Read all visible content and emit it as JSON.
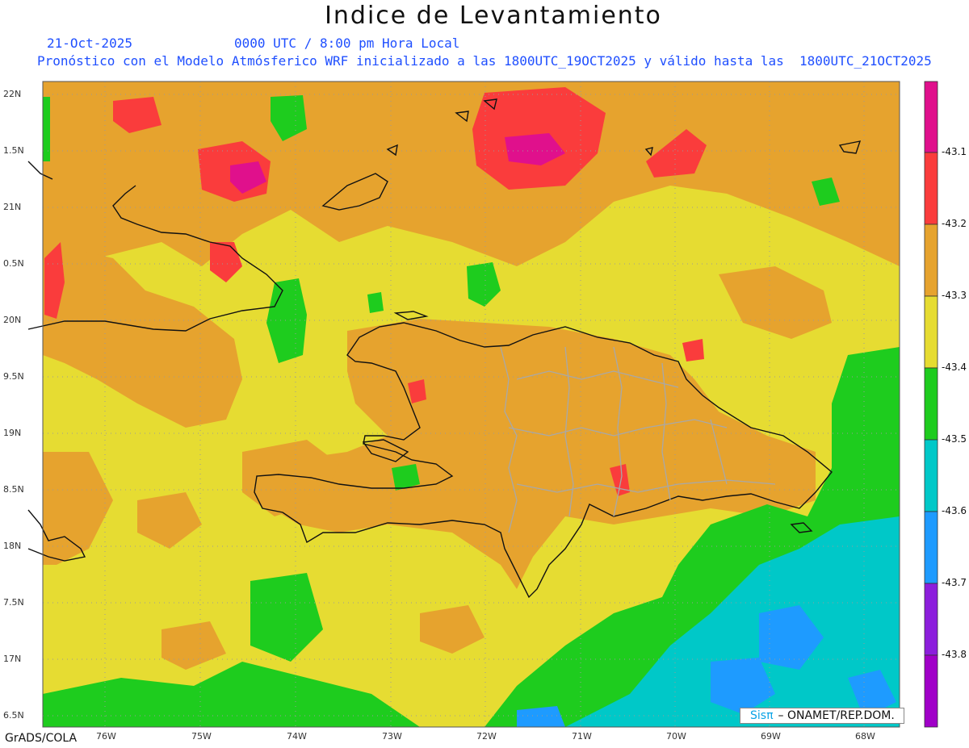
{
  "title": "Indice de Levantamiento",
  "subtitle": {
    "date": "21-Oct-2025",
    "time": "0000 UTC / 8:00 pm Hora Local",
    "forecast": "Pronóstico con el Modelo Atmósferico WRF inicializado a las 1800UTC_19OCT2025 y válido hasta las  1800UTC_21OCT2025"
  },
  "credit": "GrADS/COLA",
  "badge": {
    "logo": "Sisπ",
    "org": "– ONAMET/REP.DOM."
  },
  "latitude_labels": [
    "22N",
    "1.5N",
    "21N",
    "0.5N",
    "20N",
    "9.5N",
    "19N",
    "8.5N",
    "18N",
    "7.5N",
    "17N",
    "6.5N"
  ],
  "longitude_labels": [
    "76W",
    "75W",
    "74W",
    "73W",
    "72W",
    "71W",
    "70W",
    "69W",
    "68W"
  ],
  "colorbar": {
    "labels": [
      "-43.1",
      "-43.2",
      "-43.3",
      "-43.4",
      "-43.5",
      "-43.6",
      "-43.7",
      "-43.8"
    ],
    "colors": [
      "#e0108c",
      "#fa3c3c",
      "#e6a32e",
      "#e6dc32",
      "#1ecc1e",
      "#00c8c8",
      "#1e9bff",
      "#8c1edc",
      "#a000c8"
    ]
  },
  "field_colors": {
    "yellow": "#e6dc32",
    "orange": "#e6a32e",
    "red": "#fa3c3c",
    "magenta": "#e0108c",
    "green": "#1ecc1e",
    "cyan": "#00c8c8",
    "blue": "#1e9bff"
  }
}
